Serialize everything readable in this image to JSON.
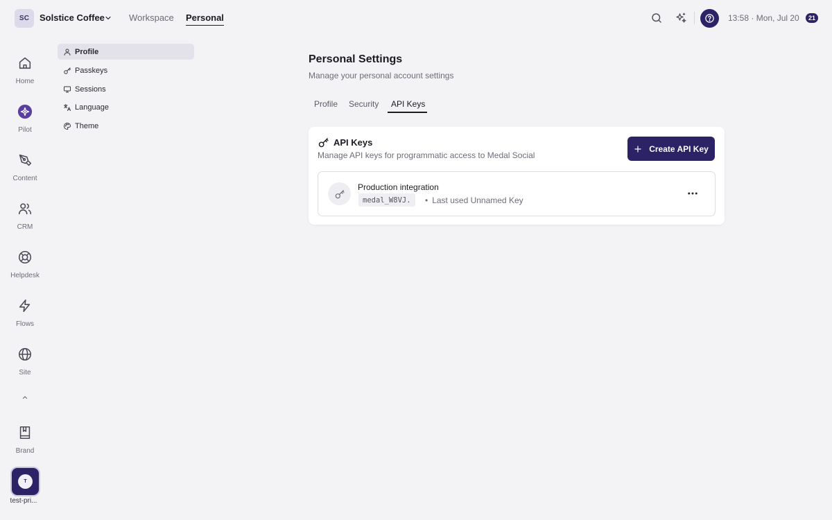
{
  "workspace": {
    "initials": "SC",
    "name": "Solstice Coffee"
  },
  "top_nav": [
    {
      "label": "Workspace"
    },
    {
      "label": "Personal"
    }
  ],
  "header": {
    "clock": "13:58 · Mon, Jul 20",
    "badge": "21"
  },
  "rail": {
    "items": [
      {
        "label": "Home",
        "icon": "home-icon"
      },
      {
        "label": "Pilot",
        "icon": "pilot-icon"
      },
      {
        "label": "Content",
        "icon": "pen-tool-icon"
      },
      {
        "label": "CRM",
        "icon": "users-icon"
      },
      {
        "label": "Helpdesk",
        "icon": "life-buoy-icon"
      },
      {
        "label": "Flows",
        "icon": "zap-icon"
      },
      {
        "label": "Site",
        "icon": "globe-icon"
      },
      {
        "label": "Brand",
        "icon": "book-icon"
      }
    ],
    "user": {
      "initial": "T",
      "label": "test-pri..."
    }
  },
  "settings_nav": [
    {
      "label": "Profile",
      "icon": "user-icon",
      "active": true
    },
    {
      "label": "Passkeys",
      "icon": "key-icon"
    },
    {
      "label": "Sessions",
      "icon": "monitor-icon"
    },
    {
      "label": "Language",
      "icon": "languages-icon"
    },
    {
      "label": "Theme",
      "icon": "palette-icon"
    }
  ],
  "main": {
    "title": "Personal Settings",
    "subtitle": "Manage your personal account settings",
    "tabs": [
      {
        "label": "Profile"
      },
      {
        "label": "Security"
      },
      {
        "label": "API Keys",
        "active": true
      }
    ]
  },
  "api_keys": {
    "title": "API Keys",
    "description": "Manage API keys for programmatic access to Medal Social",
    "create_label": "Create API Key",
    "keys": [
      {
        "name": "Production integration",
        "prefix": "medal_W8VJ.",
        "separator": "•",
        "last_used": "Last used Unnamed Key"
      }
    ]
  },
  "colors": {
    "accent": "#2c2367",
    "background": "#f3f2f5",
    "card": "#ffffff"
  }
}
